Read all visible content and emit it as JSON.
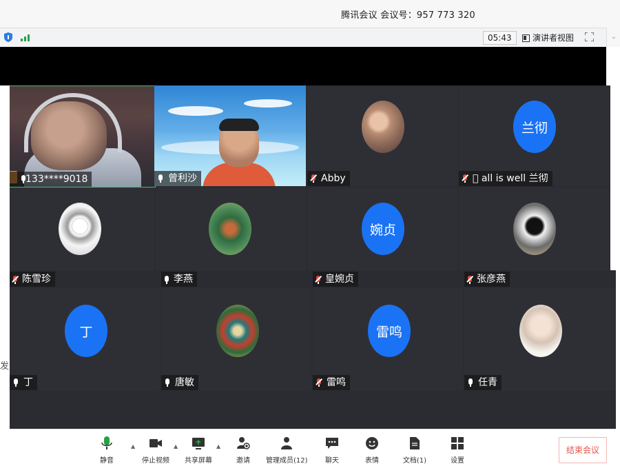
{
  "window": {
    "title": "腾讯会议 会议号：957 773 320"
  },
  "topbar": {
    "timer": "05:43",
    "presenter_view_label": "演讲者视图"
  },
  "participants_row1": [
    {
      "name": "133****9018",
      "muted": false,
      "type": "video-self"
    },
    {
      "name": "曾利沙",
      "muted": false,
      "type": "video"
    },
    {
      "name": "Abby",
      "muted": true,
      "type": "photo"
    },
    {
      "name": "􀀀 all is well 兰彻",
      "muted": true,
      "type": "initials",
      "initials": "兰彻"
    }
  ],
  "participants_row2": [
    {
      "name": "陈雪珍",
      "muted": true,
      "type": "photo"
    },
    {
      "name": "李燕",
      "muted": false,
      "type": "photo"
    },
    {
      "name": "皇婉贞",
      "muted": true,
      "type": "initials",
      "initials": "婉贞"
    },
    {
      "name": "张彦燕",
      "muted": true,
      "type": "photo"
    }
  ],
  "participants_row3": [
    {
      "name": "丁",
      "muted": false,
      "type": "initials",
      "initials": "丁"
    },
    {
      "name": "唐敏",
      "muted": false,
      "type": "photo"
    },
    {
      "name": "雷鸣",
      "muted": true,
      "type": "initials",
      "initials": "雷鸣"
    },
    {
      "name": "任青",
      "muted": false,
      "type": "photo"
    }
  ],
  "toolbar": {
    "mute": "静音",
    "stop_video": "停止视频",
    "share_screen": "共享屏幕",
    "invite": "邀请",
    "manage_members": "管理成员(12)",
    "chat": "聊天",
    "reactions": "表情",
    "documents": "文档(1)",
    "settings": "设置",
    "end_meeting": "结束会议"
  },
  "left_edge_text": "发",
  "colors": {
    "accent_blue": "#1a73f5",
    "end_red": "#e5534b",
    "mic_green": "#25a244",
    "tile_bg": "#2e2f35"
  }
}
